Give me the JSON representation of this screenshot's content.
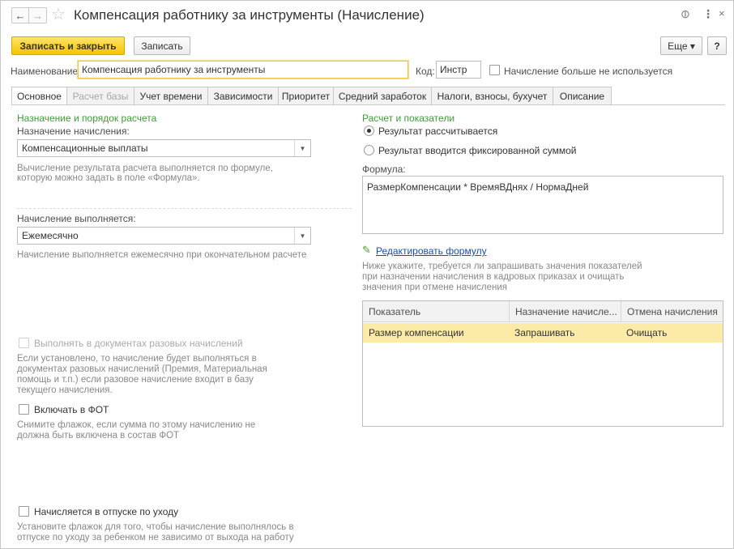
{
  "window": {
    "title": "Компенсация работнику за инструменты (Начисление)",
    "back_glyph": "←",
    "forward_glyph": "→",
    "star_glyph": "☆",
    "link_glyph": "⊘",
    "more_glyph": "⋮",
    "close_glyph": "×"
  },
  "toolbar": {
    "save_close_label": "Записать и закрыть",
    "save_label": "Записать",
    "more_label": "Еще ▾",
    "help_label": "?"
  },
  "header": {
    "name_label": "Наименование:",
    "name_value": "Компенсация работнику за инструменты",
    "code_label": "Код:",
    "code_value": "Инстр",
    "not_used_label": "Начисление больше не используется"
  },
  "tabs": [
    {
      "label": "Основное"
    },
    {
      "label": "Расчет базы"
    },
    {
      "label": "Учет времени"
    },
    {
      "label": "Зависимости"
    },
    {
      "label": "Приоритет"
    },
    {
      "label": "Средний заработок"
    },
    {
      "label": "Налоги, взносы, бухучет"
    },
    {
      "label": "Описание"
    }
  ],
  "left": {
    "section_title": "Назначение и порядок расчета",
    "purpose_label": "Назначение начисления:",
    "purpose_value": "Компенсационные выплаты",
    "purpose_hint_1": "Вычисление результата расчета выполняется по формуле,",
    "purpose_hint_2": "которую можно задать в поле «Формула».",
    "performed_label": "Начисление выполняется:",
    "performed_value": "Ежемесячно",
    "performed_hint": "Начисление выполняется ежемесячно при окончательном расчете",
    "onetime_label": "Выполнять в документах разовых начислений",
    "onetime_hint_1": "Если установлено, то начисление будет выполняться в",
    "onetime_hint_2": "документах разовых начислений (Премия, Материальная",
    "onetime_hint_3": "помощь и т.п.) если разовое начисление входит в базу",
    "onetime_hint_4": "текущего начисления.",
    "fot_label": "Включать в ФОТ",
    "fot_hint_1": "Снимите флажок, если сумма по этому начислению не",
    "fot_hint_2": "должна быть включена в состав ФОТ",
    "leave_label": "Начисляется в отпуске по уходу",
    "leave_hint_1": "Установите флажок для того, чтобы начисление выполнялось в",
    "leave_hint_2": "отпуске по уходу за ребенком не зависимо от выхода на работу"
  },
  "right": {
    "section_title": "Расчет и показатели",
    "radio_calc": "Результат рассчитывается",
    "radio_fixed": "Результат вводится фиксированной суммой",
    "formula_label": "Формула:",
    "formula_value": "РазмерКомпенсации * ВремяВДнях / НормаДней",
    "edit_formula_link": "Редактировать формулу",
    "indicators_hint_1": "Ниже укажите, требуется ли запрашивать значения показателей",
    "indicators_hint_2": "при назначении начисления в кадровых приказах и очищать",
    "indicators_hint_3": "значения при отмене начисления",
    "table": {
      "columns": [
        "Показатель",
        "Назначение начисле...",
        "Отмена начисления"
      ],
      "rows": [
        [
          "Размер компенсации",
          "Запрашивать",
          "Очищать"
        ]
      ]
    }
  }
}
